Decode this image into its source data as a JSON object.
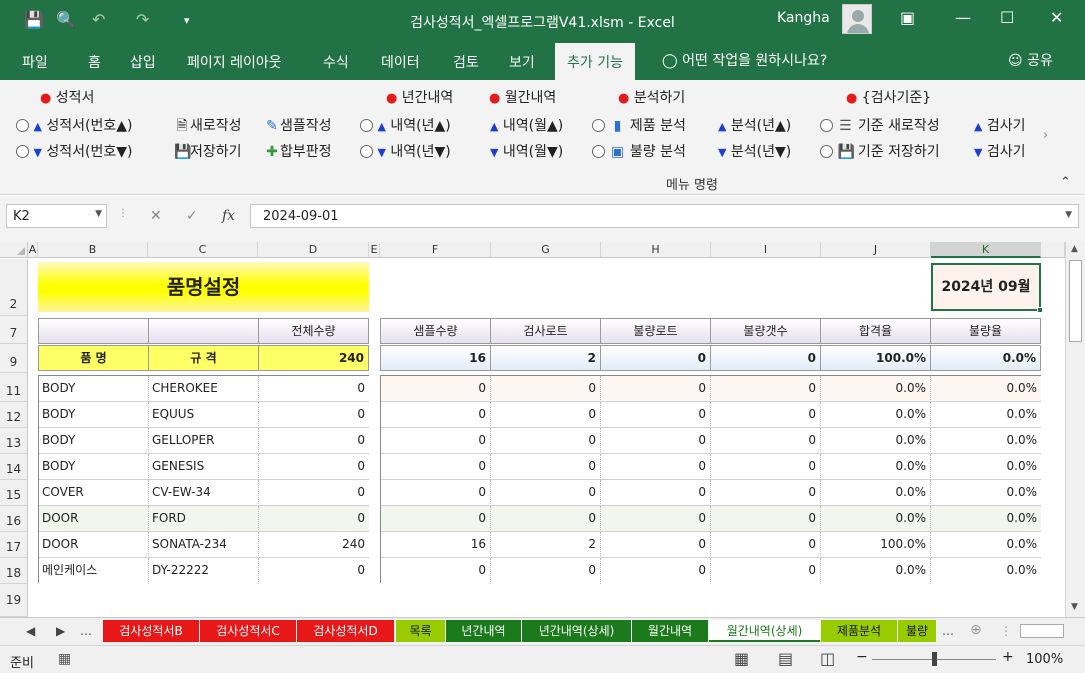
{
  "window": {
    "title": "검사성적서_엑셀프로그램V41.xlsm  -  Excel",
    "user": "Kangha",
    "colors": {
      "excel_green": "#217346",
      "tab_red": "#e81818",
      "tab_lime": "#99cc00",
      "tab_green": "#1b7a1b"
    }
  },
  "menu": {
    "items": [
      "파일",
      "홈",
      "삽입",
      "페이지 레이아웃",
      "수식",
      "데이터",
      "검토",
      "보기",
      "추가 기능"
    ],
    "active": "추가 기능",
    "tellme": "어떤 작업을 원하시나요?",
    "share": "공유"
  },
  "ribbon": {
    "group1_title": "성적서",
    "btn_report_up": "성적서(번호▲)",
    "btn_report_down": "성적서(번호▼)",
    "btn_new": "새로작성",
    "btn_save": "저장하기",
    "btn_sample": "샘플작성",
    "btn_pass": "합부판정",
    "group_year_title": "년간내역",
    "btn_year_up": "내역(년▲)",
    "btn_year_down": "내역(년▼)",
    "group_month_title": "월간내역",
    "btn_month_up": "내역(월▲)",
    "btn_month_down": "내역(월▼)",
    "group_analysis_title": "분석하기",
    "btn_product_analysis": "제품 분석",
    "btn_defect_analysis": "불량 분석",
    "btn_analysis_up": "분석(년▲)",
    "btn_analysis_down": "분석(년▼)",
    "group_criteria_title": "{검사기준}",
    "btn_criteria_new": "기준 새로작성",
    "btn_criteria_save": "기준 저장하기",
    "btn_criteria_more1": "검사기",
    "btn_criteria_more2": "검사기",
    "group_label": "메뉴 명령"
  },
  "formula_bar": {
    "name_box": "K2",
    "value": "2024-09-01"
  },
  "columns": [
    "A",
    "B",
    "C",
    "D",
    "E",
    "F",
    "G",
    "H",
    "I",
    "J",
    "K"
  ],
  "rows": [
    "2",
    "7",
    "9",
    "11",
    "12",
    "13",
    "14",
    "15",
    "16",
    "17",
    "18",
    "19"
  ],
  "sheet": {
    "banner_title": "품명설정",
    "date_display": "2024년 09월",
    "headers": {
      "total_qty": "전체수량",
      "sample_qty": "샘플수량",
      "lot_inspected": "검사로트",
      "lot_defect": "불량로트",
      "defect_count": "불량갯수",
      "pass_rate": "합격율",
      "defect_rate": "불량율"
    },
    "summary": {
      "name_label": "품  명",
      "spec_label": "규  격",
      "total_qty": "240",
      "sample_qty": "16",
      "lot_inspected": "2",
      "lot_defect": "0",
      "defect_count": "0",
      "pass_rate": "100.0%",
      "defect_rate": "0.0%"
    },
    "items": [
      {
        "name": "BODY",
        "spec": "CHEROKEE",
        "total": "0",
        "sample": "0",
        "lot": "0",
        "lot_defect": "0",
        "defect": "0",
        "pass": "0.0%",
        "defect_rate": "0.0%"
      },
      {
        "name": "BODY",
        "spec": "EQUUS",
        "total": "0",
        "sample": "0",
        "lot": "0",
        "lot_defect": "0",
        "defect": "0",
        "pass": "0.0%",
        "defect_rate": "0.0%"
      },
      {
        "name": "BODY",
        "spec": "GELLOPER",
        "total": "0",
        "sample": "0",
        "lot": "0",
        "lot_defect": "0",
        "defect": "0",
        "pass": "0.0%",
        "defect_rate": "0.0%"
      },
      {
        "name": "BODY",
        "spec": "GENESIS",
        "total": "0",
        "sample": "0",
        "lot": "0",
        "lot_defect": "0",
        "defect": "0",
        "pass": "0.0%",
        "defect_rate": "0.0%"
      },
      {
        "name": "COVER",
        "spec": "CV-EW-34",
        "total": "0",
        "sample": "0",
        "lot": "0",
        "lot_defect": "0",
        "defect": "0",
        "pass": "0.0%",
        "defect_rate": "0.0%"
      },
      {
        "name": "DOOR",
        "spec": "FORD",
        "total": "0",
        "sample": "0",
        "lot": "0",
        "lot_defect": "0",
        "defect": "0",
        "pass": "0.0%",
        "defect_rate": "0.0%"
      },
      {
        "name": "DOOR",
        "spec": "SONATA-234",
        "total": "240",
        "sample": "16",
        "lot": "2",
        "lot_defect": "0",
        "defect": "0",
        "pass": "100.0%",
        "defect_rate": "0.0%"
      },
      {
        "name": "메인케이스",
        "spec": "DY-22222",
        "total": "0",
        "sample": "0",
        "lot": "0",
        "lot_defect": "0",
        "defect": "0",
        "pass": "0.0%",
        "defect_rate": "0.0%"
      }
    ]
  },
  "sheet_tabs": [
    {
      "label": "검사성적서B",
      "color": "red"
    },
    {
      "label": "검사성적서C",
      "color": "red"
    },
    {
      "label": "검사성적서D",
      "color": "red"
    },
    {
      "label": "목록",
      "color": "lime"
    },
    {
      "label": "년간내역",
      "color": "green"
    },
    {
      "label": "년간내역(상세)",
      "color": "green"
    },
    {
      "label": "월간내역",
      "color": "green"
    },
    {
      "label": "월간내역(상세)",
      "color": "active"
    },
    {
      "label": "제품분석",
      "color": "lime"
    },
    {
      "label": "불량",
      "color": "lime"
    }
  ],
  "status": {
    "ready": "준비",
    "zoom": "100%"
  }
}
